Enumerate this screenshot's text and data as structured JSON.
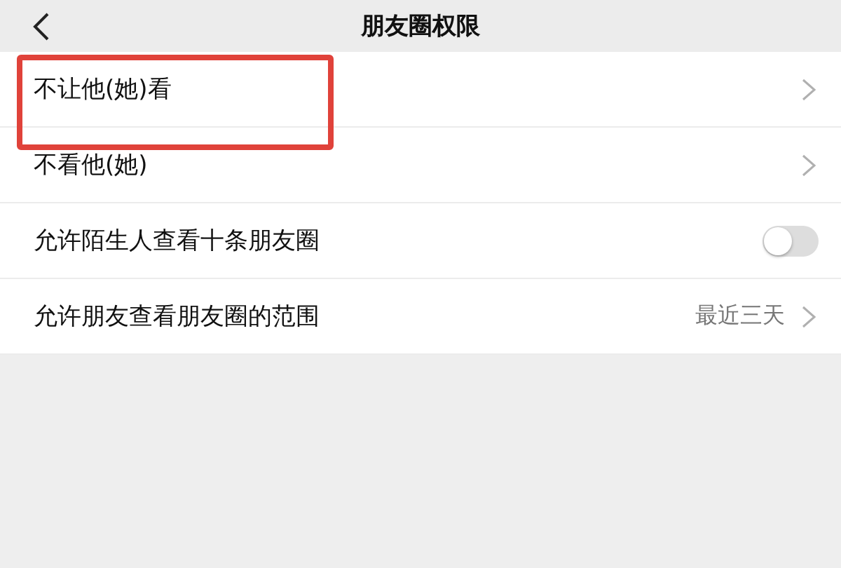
{
  "header": {
    "title": "朋友圈权限"
  },
  "items": [
    {
      "kind": "link",
      "label": "不让他(她)看",
      "highlighted": true
    },
    {
      "kind": "link",
      "label": "不看他(她)",
      "highlighted": false
    },
    {
      "kind": "toggle",
      "label": "允许陌生人查看十条朋友圈",
      "on": false,
      "highlighted": false
    },
    {
      "kind": "link",
      "label": "允许朋友查看朋友圈的范围",
      "value": "最近三天",
      "highlighted": false
    }
  ]
}
